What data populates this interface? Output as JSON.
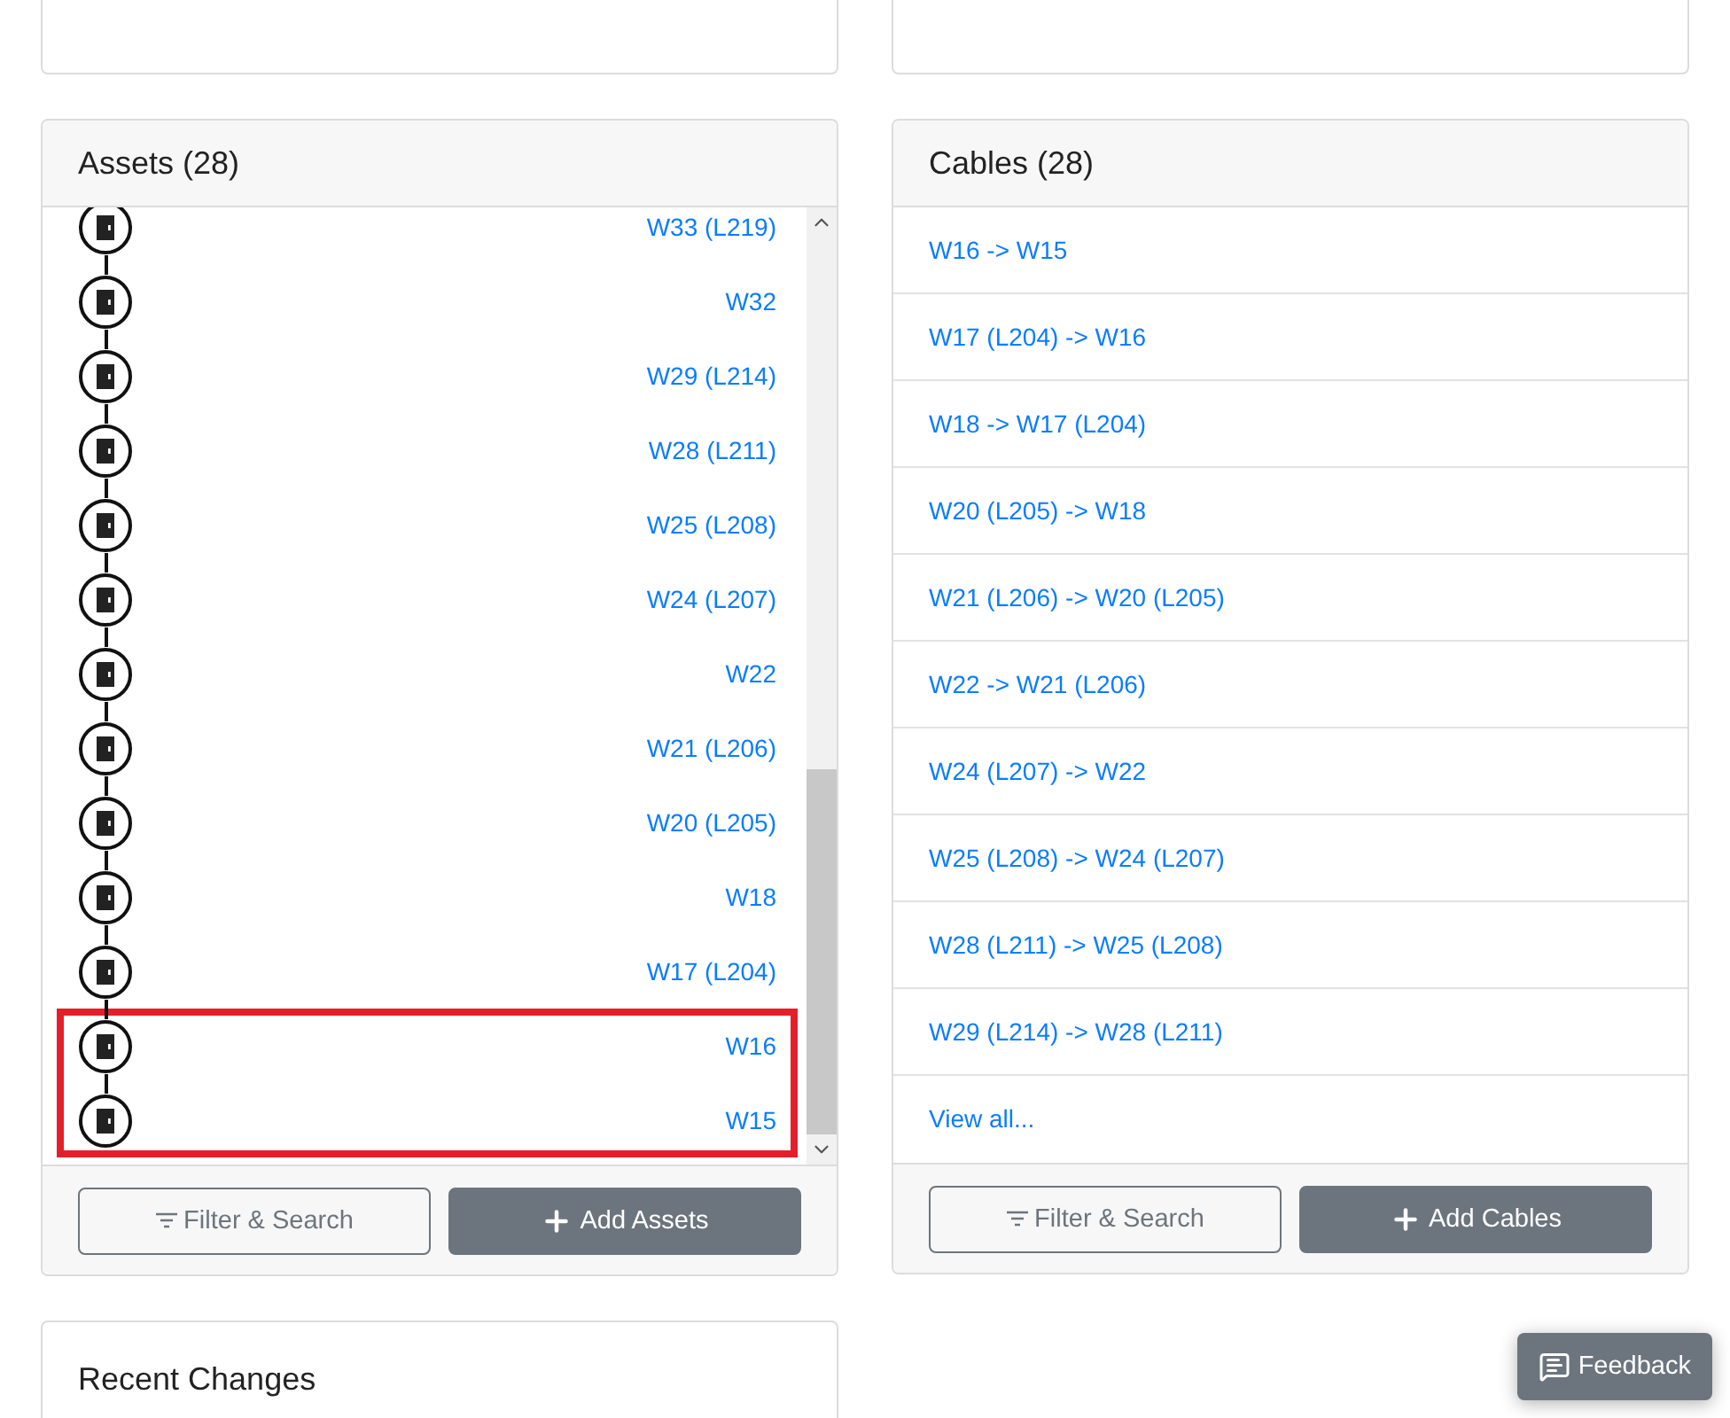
{
  "assets": {
    "title": "Assets (28)",
    "items": [
      {
        "label": "W33 (L219)",
        "highlighted": false
      },
      {
        "label": "W32",
        "highlighted": false
      },
      {
        "label": "W29 (L214)",
        "highlighted": false
      },
      {
        "label": "W28 (L211)",
        "highlighted": false
      },
      {
        "label": "W25 (L208)",
        "highlighted": false
      },
      {
        "label": "W24 (L207)",
        "highlighted": false
      },
      {
        "label": "W22",
        "highlighted": false
      },
      {
        "label": "W21 (L206)",
        "highlighted": false
      },
      {
        "label": "W20 (L205)",
        "highlighted": false
      },
      {
        "label": "W18",
        "highlighted": false
      },
      {
        "label": "W17 (L204)",
        "highlighted": false
      },
      {
        "label": "W16",
        "highlighted": true
      },
      {
        "label": "W15",
        "highlighted": true
      }
    ],
    "filter_button": "Filter & Search",
    "add_button": "Add Assets"
  },
  "cables": {
    "title": "Cables (28)",
    "items": [
      "W16 -> W15",
      "W17 (L204) -> W16",
      "W18 -> W17 (L204)",
      "W20 (L205) -> W18",
      "W21 (L206) -> W20 (L205)",
      "W22 -> W21 (L206)",
      "W24 (L207) -> W22",
      "W25 (L208) -> W24 (L207)",
      "W28 (L211) -> W25 (L208)",
      "W29 (L214) -> W28 (L211)"
    ],
    "view_all": "View all...",
    "filter_button": "Filter & Search",
    "add_button": "Add Cables"
  },
  "recent_changes": {
    "title": "Recent Changes"
  },
  "feedback_button": "Feedback"
}
